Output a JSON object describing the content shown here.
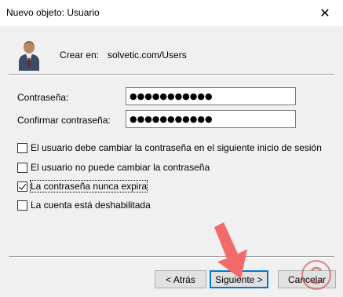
{
  "window": {
    "title": "Nuevo objeto: Usuario",
    "close_glyph": "✕"
  },
  "header": {
    "icon": "user-icon",
    "create_label": "Crear en:",
    "create_value": "solvetic.com/Users"
  },
  "form": {
    "password_label": "Contraseña:",
    "password_value": "●●●●●●●●●●●",
    "confirm_label": "Confirmar contraseña:",
    "confirm_value": "●●●●●●●●●●●"
  },
  "options": [
    {
      "label": "El usuario debe cambiar la contraseña en el siguiente inicio de sesión",
      "checked": false
    },
    {
      "label": "El usuario no puede cambiar la contraseña",
      "checked": false
    },
    {
      "label": "La contraseña nunca expira",
      "checked": true
    },
    {
      "label": "La cuenta está deshabilitada",
      "checked": false
    }
  ],
  "buttons": {
    "back": "< Atrás",
    "next": "Siguiente >",
    "cancel": "Cancelar"
  },
  "colors": {
    "accent": "#0078d7",
    "annotation_arrow": "#f26a6a"
  }
}
